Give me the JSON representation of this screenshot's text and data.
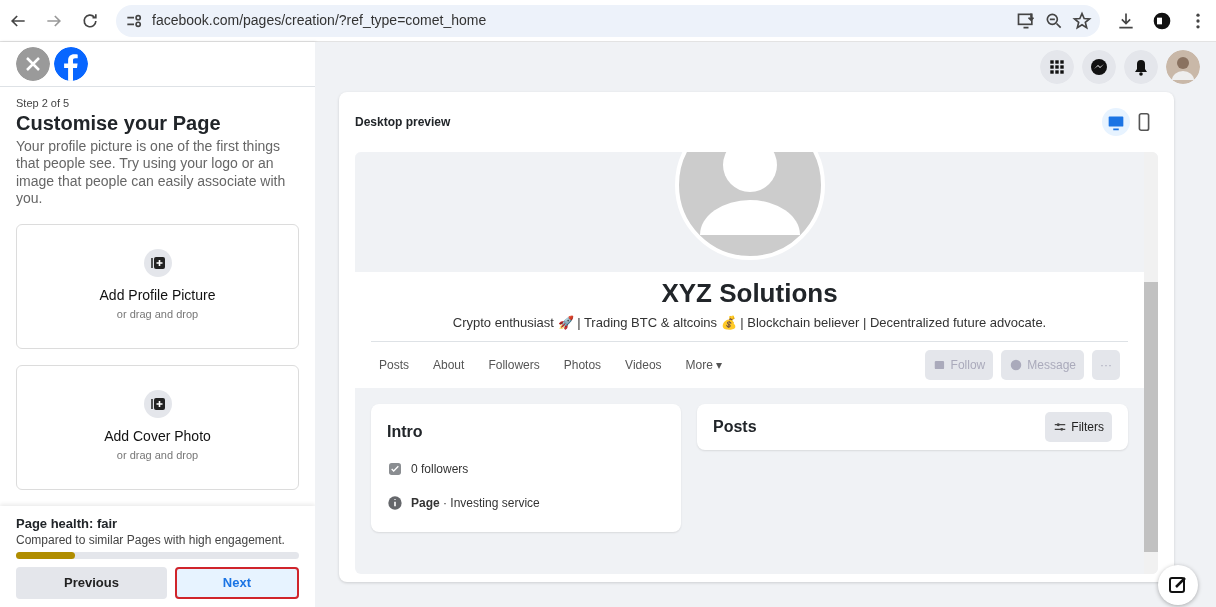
{
  "browser": {
    "url": "facebook.com/pages/creation/?ref_type=comet_home"
  },
  "sidebar": {
    "step": "Step 2 of 5",
    "title": "Customise your Page",
    "description": "Your profile picture is one of the first things that people see. Try using your logo or an image that people can easily associate with you.",
    "uploads": [
      {
        "title": "Add Profile Picture",
        "hint": "or drag and drop"
      },
      {
        "title": "Add Cover Photo",
        "hint": "or drag and drop"
      }
    ],
    "health": {
      "title": "Page health: fair",
      "description": "Compared to similar Pages with high engagement.",
      "level": 0.21
    },
    "buttons": [
      {
        "label": "Previous",
        "highlighted": false
      },
      {
        "label": "Next",
        "highlighted": true
      }
    ]
  },
  "preview": {
    "title": "Desktop preview",
    "devices": [
      {
        "kind": "desktop",
        "selected": true
      },
      {
        "kind": "mobile",
        "selected": false
      }
    ],
    "page_name": "XYZ Solutions",
    "bio": "Crypto enthusiast 🚀 | Trading BTC & altcoins 💰 | Blockchain believer | Decentralized future advocate.",
    "tabs": [
      "Posts",
      "About",
      "Followers",
      "Photos",
      "Videos",
      "More ▾"
    ],
    "actions": [
      {
        "kind": "follow",
        "label": "Follow",
        "disabled": true
      },
      {
        "kind": "message",
        "label": "Message",
        "disabled": true
      },
      {
        "kind": "more",
        "label": "···",
        "disabled": true
      }
    ],
    "intro": {
      "title": "Intro",
      "items": [
        {
          "kind": "followers",
          "text": "0 followers"
        },
        {
          "kind": "info",
          "text": "**Page** · Investing service"
        }
      ]
    },
    "posts": {
      "title": "Posts",
      "filter": "Filters"
    }
  }
}
